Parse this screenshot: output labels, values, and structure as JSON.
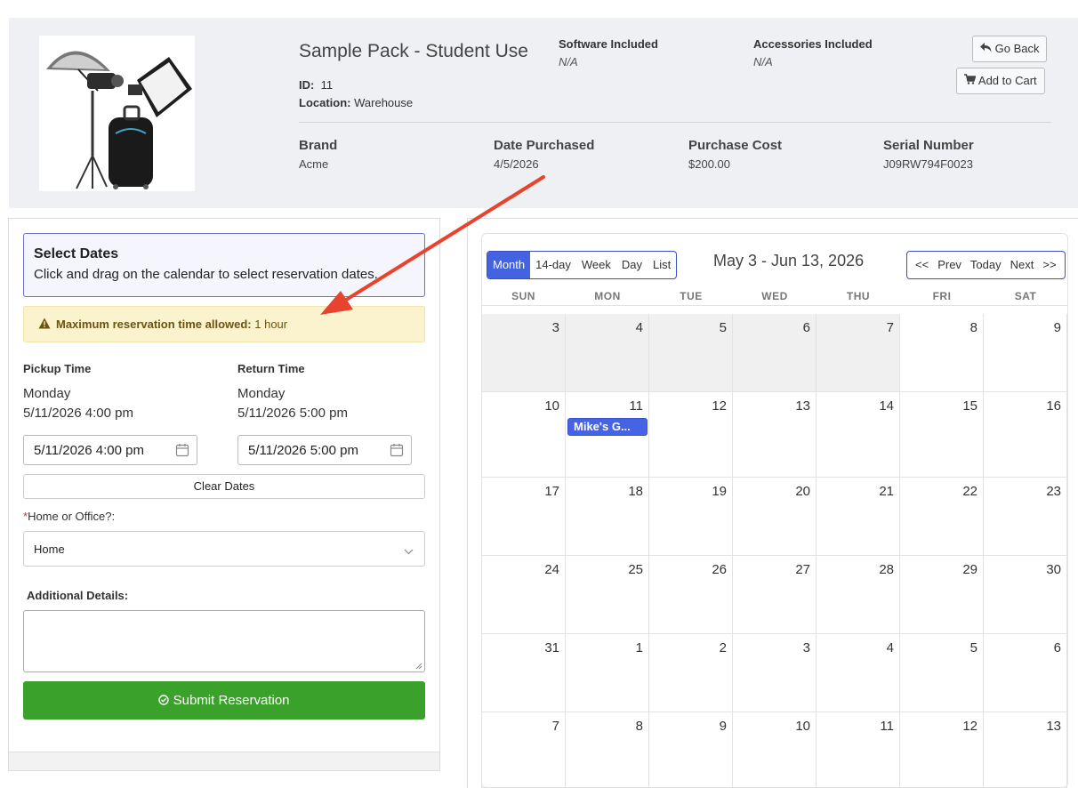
{
  "item": {
    "title": "Sample Pack - Student Use",
    "id_label": "ID:",
    "id_value": "11",
    "location_label": "Location:",
    "location_value": "Warehouse",
    "software_label": "Software Included",
    "software_value": "N/A",
    "accessories_label": "Accessories Included",
    "accessories_value": "N/A",
    "brand_label": "Brand",
    "brand_value": "Acme",
    "date_label": "Date Purchased",
    "date_value": "4/5/2026",
    "cost_label": "Purchase Cost",
    "cost_value": "$200.00",
    "serial_label": "Serial Number",
    "serial_value": "J09RW794F0023"
  },
  "actions": {
    "go_back": "Go Back",
    "add_to_cart": "Add to Cart"
  },
  "form": {
    "select_title": "Select Dates",
    "select_desc": "Click and drag on the calendar to select reservation dates.",
    "warning_bold": "Maximum reservation time allowed:",
    "warning_value": "1 hour",
    "pickup_label": "Pickup Time",
    "pickup_day": "Monday",
    "pickup_datetime": "5/11/2026 4:00 pm",
    "pickup_input": "5/11/2026 4:00 pm",
    "return_label": "Return Time",
    "return_day": "Monday",
    "return_datetime": "5/11/2026 5:00 pm",
    "return_input": "5/11/2026 5:00 pm",
    "clear_dates": "Clear Dates",
    "required_mark": "*",
    "home_label": "Home or Office?:",
    "home_value": "Home",
    "details_label": "Additional Details:",
    "submit": "Submit Reservation"
  },
  "calendar": {
    "views": [
      "Month",
      "14-day",
      "Week",
      "Day",
      "List"
    ],
    "active_view": "Month",
    "title": "May 3 - Jun 13, 2026",
    "nav": [
      "<<",
      "Prev",
      "Today",
      "Next",
      ">>"
    ],
    "weekdays": [
      "SUN",
      "MON",
      "TUE",
      "WED",
      "THU",
      "FRI",
      "SAT"
    ],
    "weeks": [
      [
        "3",
        "4",
        "5",
        "6",
        "7",
        "8",
        "9"
      ],
      [
        "10",
        "11",
        "12",
        "13",
        "14",
        "15",
        "16"
      ],
      [
        "17",
        "18",
        "19",
        "20",
        "21",
        "22",
        "23"
      ],
      [
        "24",
        "25",
        "26",
        "27",
        "28",
        "29",
        "30"
      ],
      [
        "31",
        "1",
        "2",
        "3",
        "4",
        "5",
        "6"
      ],
      [
        "7",
        "8",
        "9",
        "10",
        "11",
        "12",
        "13"
      ]
    ],
    "past_days_in_first_week": 5,
    "event": {
      "title": "Mike's G...",
      "color": "#4663e6"
    }
  },
  "colors": {
    "accent": "#4463e0",
    "submit": "#3aa22a",
    "warning_bg": "#fbf3cd",
    "annotation_arrow": "#e8432d"
  }
}
